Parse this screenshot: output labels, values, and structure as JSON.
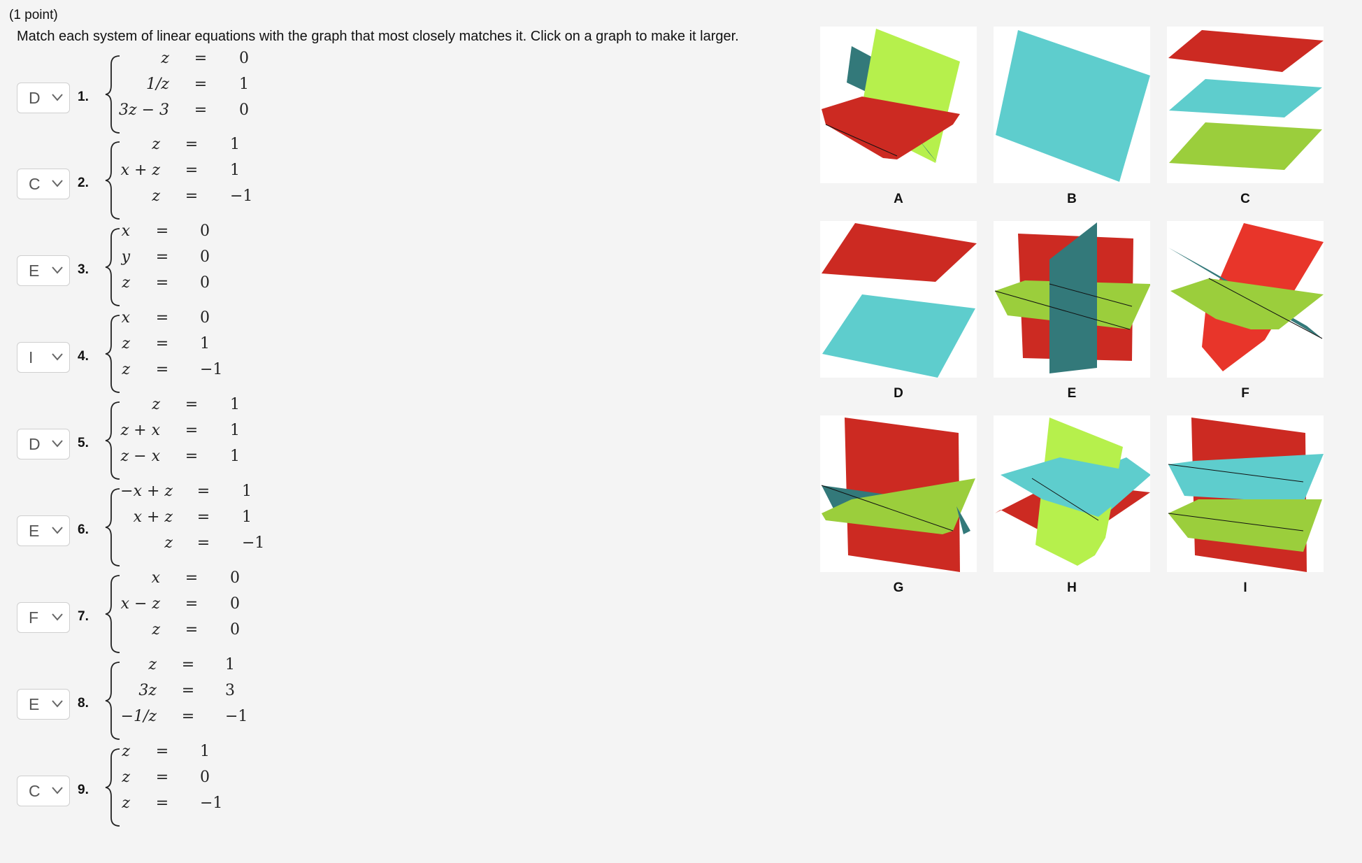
{
  "header": "(1 point)",
  "instructions": "Match each system of linear equations with the graph that most closely matches it. Click on a graph to make it larger.",
  "relation_symbol": "=",
  "problems": [
    {
      "number": "1.",
      "selected": "D",
      "equations": [
        {
          "lhs": "z",
          "rhs": "0"
        },
        {
          "lhs": "1/z",
          "rhs": "1"
        },
        {
          "lhs": "3z − 3",
          "rhs": "0"
        }
      ]
    },
    {
      "number": "2.",
      "selected": "C",
      "equations": [
        {
          "lhs": "z",
          "rhs": "1"
        },
        {
          "lhs": "x + z",
          "rhs": "1"
        },
        {
          "lhs": "z",
          "rhs": "−1"
        }
      ]
    },
    {
      "number": "3.",
      "selected": "E",
      "equations": [
        {
          "lhs": "x",
          "rhs": "0"
        },
        {
          "lhs": "y",
          "rhs": "0"
        },
        {
          "lhs": "z",
          "rhs": "0"
        }
      ]
    },
    {
      "number": "4.",
      "selected": "I",
      "equations": [
        {
          "lhs": "x",
          "rhs": "0"
        },
        {
          "lhs": "z",
          "rhs": "1"
        },
        {
          "lhs": "z",
          "rhs": "−1"
        }
      ]
    },
    {
      "number": "5.",
      "selected": "D",
      "equations": [
        {
          "lhs": "z",
          "rhs": "1"
        },
        {
          "lhs": "z + x",
          "rhs": "1"
        },
        {
          "lhs": "z − x",
          "rhs": "1"
        }
      ]
    },
    {
      "number": "6.",
      "selected": "E",
      "equations": [
        {
          "lhs": "−x + z",
          "rhs": "1"
        },
        {
          "lhs": "x + z",
          "rhs": "1"
        },
        {
          "lhs": "z",
          "rhs": "−1"
        }
      ]
    },
    {
      "number": "7.",
      "selected": "F",
      "equations": [
        {
          "lhs": "x",
          "rhs": "0"
        },
        {
          "lhs": "x − z",
          "rhs": "0"
        },
        {
          "lhs": "z",
          "rhs": "0"
        }
      ]
    },
    {
      "number": "8.",
      "selected": "E",
      "equations": [
        {
          "lhs": "z",
          "rhs": "1"
        },
        {
          "lhs": "3z",
          "rhs": "3"
        },
        {
          "lhs": "−1/z",
          "rhs": "−1"
        }
      ]
    },
    {
      "number": "9.",
      "selected": "C",
      "equations": [
        {
          "lhs": "z",
          "rhs": "1"
        },
        {
          "lhs": "z",
          "rhs": "0"
        },
        {
          "lhs": "z",
          "rhs": "−1"
        }
      ]
    }
  ],
  "graphs": [
    {
      "label": "A"
    },
    {
      "label": "B"
    },
    {
      "label": "C"
    },
    {
      "label": "D"
    },
    {
      "label": "E"
    },
    {
      "label": "F"
    },
    {
      "label": "G"
    },
    {
      "label": "H"
    },
    {
      "label": "I"
    }
  ],
  "colors": {
    "red": "#cc2a22",
    "bright_red": "#e8352a",
    "cyan": "#5ecdcd",
    "teal": "#33797a",
    "lime": "#b6f04c",
    "green": "#9bce3c",
    "edge": "#111111"
  }
}
